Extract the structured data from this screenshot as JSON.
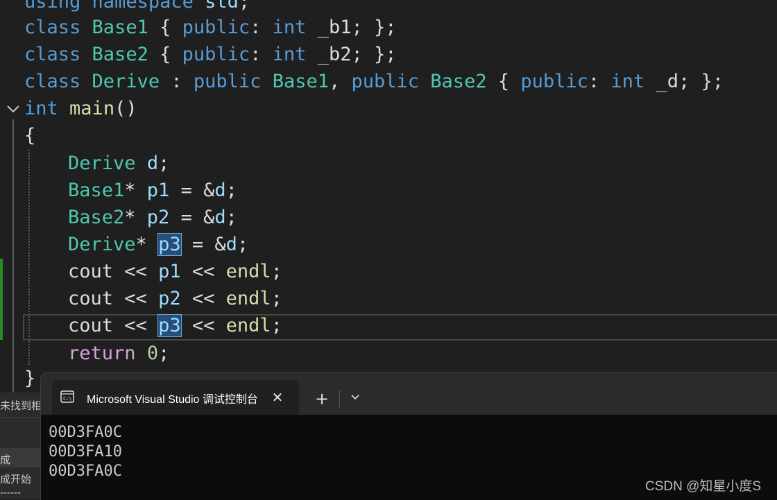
{
  "code": {
    "line0": {
      "kw1": "using",
      "kw2": "namespace",
      "id": "std",
      "punc": ";"
    },
    "line1": {
      "k": "class",
      "t": "Base1",
      "o": " { ",
      "p": "public",
      "c": ": ",
      "i": "int",
      "v": " _b1",
      "e": "; };"
    },
    "line2": {
      "k": "class",
      "t": "Base2",
      "o": " { ",
      "p": "public",
      "c": ": ",
      "i": "int",
      "v": " _b2",
      "e": "; };"
    },
    "line3": {
      "k": "class",
      "t": "Derive",
      "c1": " : ",
      "p1": "public",
      "t1": "Base1",
      "cm": ", ",
      "p2": "public",
      "t2": "Base2",
      "o": " { ",
      "p3": "public",
      "c2": ": ",
      "i": "int",
      "v": " _d",
      "e": "; };"
    },
    "line4": {
      "i": "int",
      "f": "main",
      "pp": "()"
    },
    "line5": {
      "b": "{"
    },
    "line6": {
      "t": "Derive",
      "v": "d",
      "e": ";"
    },
    "line7": {
      "t": "Base1",
      "s": "* ",
      "v": "p1",
      "eq": " = &",
      "r": "d",
      "e": ";"
    },
    "line8": {
      "t": "Base2",
      "s": "* ",
      "v": "p2",
      "eq": " = &",
      "r": "d",
      "e": ";"
    },
    "line9": {
      "t": "Derive",
      "s": "* ",
      "v": "p3",
      "eq": " = &",
      "r": "d",
      "e": ";"
    },
    "line10": {
      "c": "cout",
      "op1": " << ",
      "v": "p1",
      "op2": " << ",
      "f": "endl",
      "e": ";"
    },
    "line11": {
      "c": "cout",
      "op1": " << ",
      "v": "p2",
      "op2": " << ",
      "f": "endl",
      "e": ";"
    },
    "line12": {
      "c": "cout",
      "op1": " << ",
      "v": "p3",
      "op2": " << ",
      "f": "endl",
      "e": ";"
    },
    "line13": {
      "r": "return",
      "n": "0",
      "e": ";"
    },
    "line14": {
      "b": "}"
    }
  },
  "side_panel": {
    "line1": "未找到相",
    "line2": "成",
    "line3": "成开始",
    "line4": "------"
  },
  "terminal": {
    "tab_title": "Microsoft Visual Studio 调试控制台",
    "close_glyph": "✕",
    "new_tab_glyph": "+",
    "dropdown_glyph": "⌵",
    "output": [
      "00D3FA0C",
      "00D3FA10",
      "00D3FA0C"
    ]
  },
  "watermark": "CSDN @知星小度S",
  "colors": {
    "keyword": "#569cd6",
    "type": "#4ec9b0",
    "variable": "#9cdcfe",
    "function": "#dcdcaa",
    "control": "#d8a0df",
    "number": "#b5cea8",
    "editor_bg": "#1f1f1f",
    "terminal_bg": "#0c0c0c",
    "selection": "#264f78"
  }
}
